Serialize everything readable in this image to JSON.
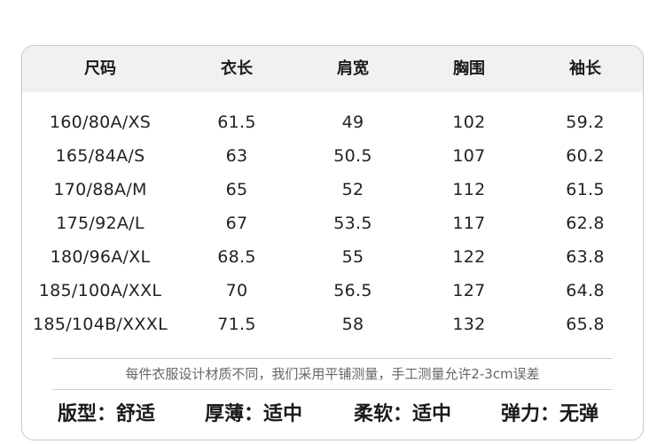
{
  "table": {
    "headers": [
      "尺码",
      "衣长",
      "肩宽",
      "胸围",
      "袖长"
    ],
    "rows": [
      [
        "160/80A/XS",
        "61.5",
        "49",
        "102",
        "59.2"
      ],
      [
        "165/84A/S",
        "63",
        "50.5",
        "107",
        "60.2"
      ],
      [
        "170/88A/M",
        "65",
        "52",
        "112",
        "61.5"
      ],
      [
        "175/92A/L",
        "67",
        "53.5",
        "117",
        "62.8"
      ],
      [
        "180/96A/XL",
        "68.5",
        "55",
        "122",
        "63.8"
      ],
      [
        "185/100A/XXL",
        "70",
        "56.5",
        "127",
        "64.8"
      ],
      [
        "185/104B/XXXL",
        "71.5",
        "58",
        "132",
        "65.8"
      ]
    ]
  },
  "note": "每件衣服设计材质不同，我们采用平铺测量，手工测量允许2-3cm误差",
  "attributes": [
    "版型：舒适",
    "厚薄：适中",
    "柔软：适中",
    "弹力：无弹"
  ]
}
